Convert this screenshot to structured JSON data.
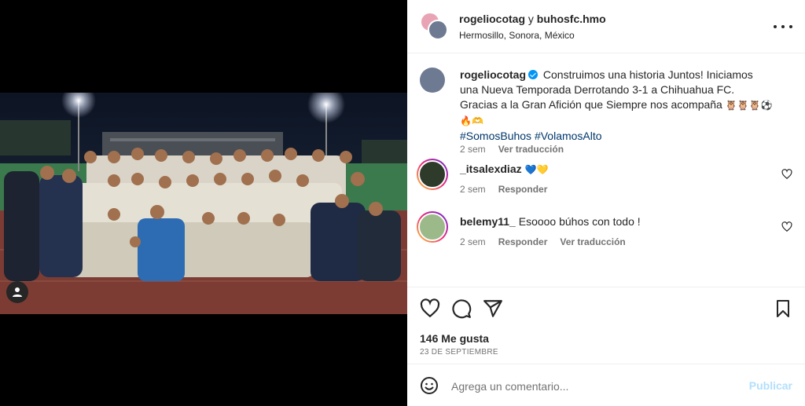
{
  "post": {
    "header": {
      "user1": "rogeliocotag",
      "conjunction": "y",
      "user2": "buhosfc.hmo",
      "location": "Hermosillo, Sonora, México"
    },
    "caption": {
      "username": "rogeliocotag",
      "text": "Construimos una historia Juntos! Iniciamos una Nueva Temporada Derrotando 3-1 a Chihuahua FC. Gracias a la Gran Afición que Siempre nos acompaña",
      "emojis": "🦉🦉🦉⚽🔥🫶",
      "hashtag1": "#SomosBuhos",
      "hashtag2": "#VolamosAlto",
      "time": "2 sem",
      "translate": "Ver traducción"
    },
    "comments": [
      {
        "username": "_itsalexdiaz",
        "text": "💙💛",
        "time": "2 sem",
        "reply": "Responder"
      },
      {
        "username": "belemy11_",
        "text": "Esoooo búhos con todo !",
        "time": "2 sem",
        "reply": "Responder",
        "translate": "Ver traducción"
      }
    ],
    "likes": "146 Me gusta",
    "date": "23 DE SEPTIEMBRE",
    "add_comment": {
      "placeholder": "Agrega un comentario...",
      "post_label": "Publicar"
    }
  },
  "colors": {
    "link": "#00376b",
    "secondary_text": "#737373",
    "verified": "#0095f6",
    "post_button_disabled": "#b2dffc"
  },
  "icons": [
    "tag-user-icon",
    "more-options-icon",
    "verified-badge-icon",
    "heart-icon",
    "comment-icon",
    "share-icon",
    "bookmark-icon",
    "smiley-icon"
  ]
}
